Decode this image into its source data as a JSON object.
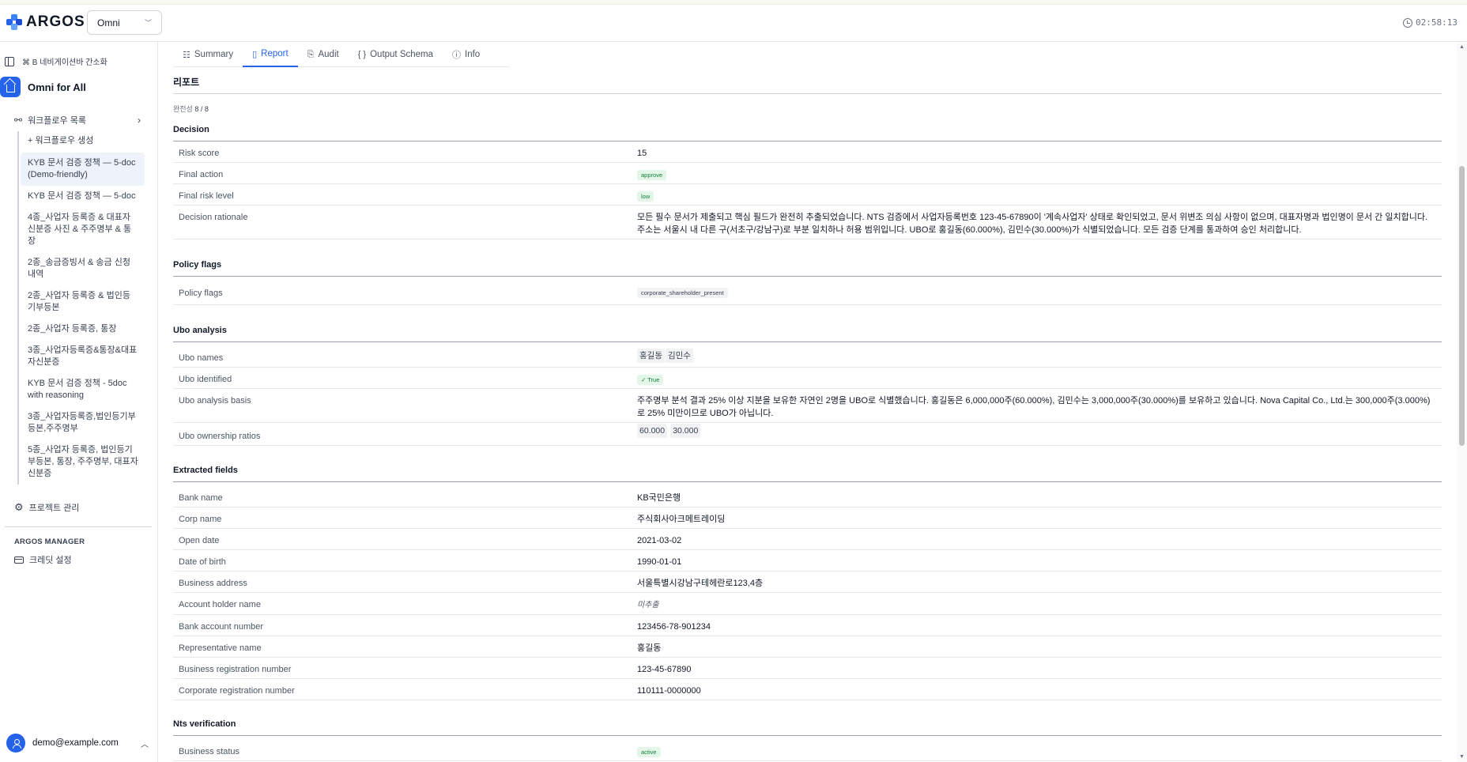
{
  "brand": {
    "name": "ARGOS"
  },
  "workspace": {
    "selected": "Omni"
  },
  "clock": {
    "time": "02:58:13"
  },
  "sidebar": {
    "shortcut_hint": "⌘ B 네비게이션바 간소화",
    "project_name": "Omni for All",
    "workflow_header": "워크플로우 목록",
    "create_label": "+ 워크플로우 생성",
    "workflows": [
      "KYB 문서 검증 정책 — 5-doc (Demo-friendly)",
      "KYB 문서 검증 정책 — 5-doc",
      "4종_사업자 등록증 & 대표자 신분증 사진 & 주주명부 & 통장",
      "2종_송금증빙서 & 송금 신청 내역",
      "2종_사업자 등록증 & 법인등기부등본",
      "2종_사업자 등록증, 통장",
      "3종_사업자등록증&통장&대표자신분증",
      "KYB 문서 검증 정책 - 5doc with reasoning",
      "3종_사업자등록증,법인등기부등본,주주명부",
      "5종_사업자 등록증, 법인등기부등본, 통장, 주주명부, 대표자 신분증"
    ],
    "project_mgmt": "프로젝트 관리",
    "manager_title": "ARGOS MANAGER",
    "credit_settings": "크레딧 설정",
    "user_email": "demo@example.com"
  },
  "tabs": [
    {
      "label": "Summary",
      "icon": "list-check-icon"
    },
    {
      "label": "Report",
      "icon": "document-icon"
    },
    {
      "label": "Audit",
      "icon": "audit-icon"
    },
    {
      "label": "Output Schema",
      "icon": "braces-icon"
    },
    {
      "label": "Info",
      "icon": "info-icon"
    }
  ],
  "report": {
    "title": "리포트",
    "completeness_label": "완전성",
    "completeness_value": "8 / 8",
    "decision": {
      "title": "Decision",
      "risk_score_label": "Risk score",
      "risk_score": "15",
      "final_action_label": "Final action",
      "final_action": "approve",
      "final_risk_level_label": "Final risk level",
      "final_risk_level": "low",
      "rationale_label": "Decision rationale",
      "rationale": "모든 필수 문서가 제출되고 핵심 필드가 완전히 추출되었습니다. NTS 검증에서 사업자등록번호 123-45-67890이 '계속사업자' 상태로 확인되었고, 문서 위변조 의심 사항이 없으며, 대표자명과 법인명이 문서 간 일치합니다. 주소는 서울시 내 다른 구(서초구/강남구)로 부분 일치하나 허용 범위입니다. UBO로 홍길동(60.000%), 김민수(30.000%)가 식별되었습니다. 모든 검증 단계를 통과하여 승인 처리합니다."
    },
    "policy_flags": {
      "title": "Policy flags",
      "label": "Policy flags",
      "value": "corporate_shareholder_present"
    },
    "ubo": {
      "title": "Ubo analysis",
      "names_label": "Ubo names",
      "names": [
        "홍길동",
        "김민수"
      ],
      "identified_label": "Ubo identified",
      "identified": "True",
      "basis_label": "Ubo analysis basis",
      "basis": "주주명부 분석 결과 25% 이상 지분을 보유한 자연인 2명을 UBO로 식별했습니다. 홍길동은 6,000,000주(60.000%), 김민수는 3,000,000주(30.000%)를 보유하고 있습니다. Nova Capital Co., Ltd.는 300,000주(3.000%)로 25% 미만이므로 UBO가 아닙니다.",
      "ratios_label": "Ubo ownership ratios",
      "ratios": [
        "60.000",
        "30.000"
      ]
    },
    "extracted": {
      "title": "Extracted fields",
      "rows": [
        {
          "label": "Bank name",
          "value": "KB국민은행"
        },
        {
          "label": "Corp name",
          "value": "주식회사아크메트레이딩"
        },
        {
          "label": "Open date",
          "value": "2021-03-02"
        },
        {
          "label": "Date of birth",
          "value": "1990-01-01"
        },
        {
          "label": "Business address",
          "value": "서울특별시강남구테헤란로123,4층"
        },
        {
          "label": "Account holder name",
          "value": "미추출"
        },
        {
          "label": "Bank account number",
          "value": "123456-78-901234"
        },
        {
          "label": "Representative name",
          "value": "홍길동"
        },
        {
          "label": "Business registration number",
          "value": "123-45-67890"
        },
        {
          "label": "Corporate registration number",
          "value": "110111-0000000"
        }
      ]
    },
    "nts": {
      "title": "Nts verification",
      "business_status_label": "Business status",
      "business_status": "active"
    }
  },
  "colors": {
    "accent": "#2563eb",
    "success_bg": "#e3f6e8",
    "success_text": "#15803d"
  }
}
